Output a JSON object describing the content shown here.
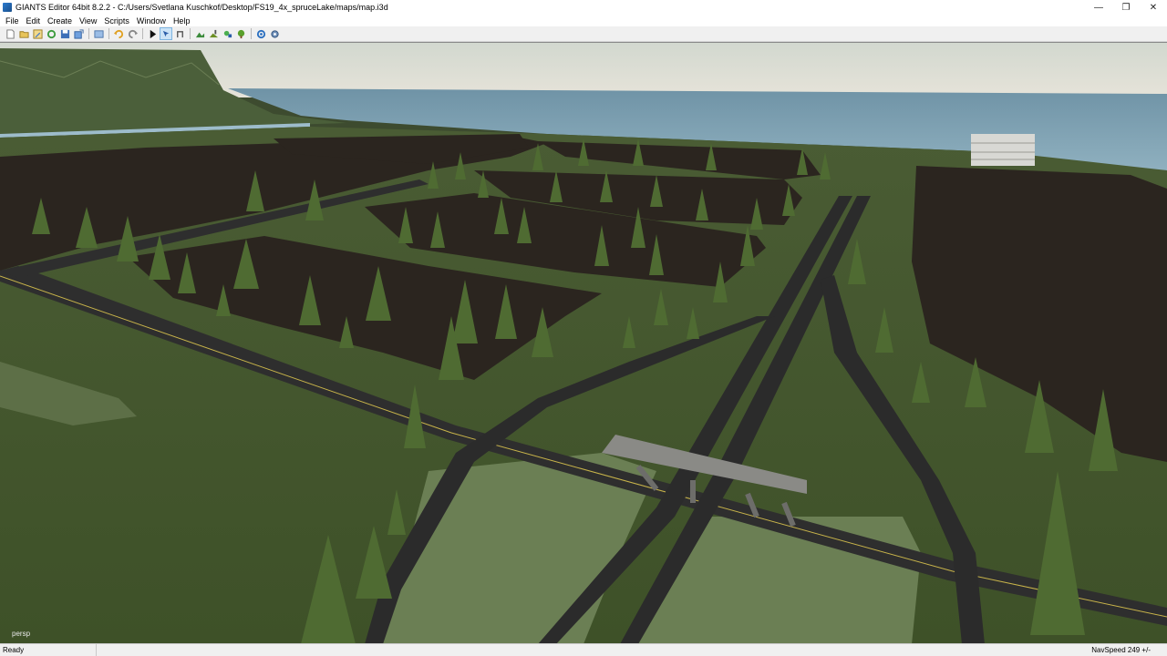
{
  "window": {
    "title": "GIANTS Editor 64bit 8.2.2 - C:/Users/Svetlana Kuschkof/Desktop/FS19_4x_spruceLake/maps/map.i3d",
    "minimize_glyph": "—",
    "maximize_glyph": "❐",
    "close_glyph": "✕"
  },
  "menu": [
    {
      "label": "File"
    },
    {
      "label": "Edit"
    },
    {
      "label": "Create"
    },
    {
      "label": "View"
    },
    {
      "label": "Scripts"
    },
    {
      "label": "Window"
    },
    {
      "label": "Help"
    }
  ],
  "toolbar": {
    "icons": [
      "new-icon",
      "open-icon",
      "save-as-icon",
      "reload-icon",
      "save-icon",
      "export-icon",
      "undo-history-icon",
      "undo-icon",
      "redo-icon",
      "play-icon",
      "select-tool-icon",
      "move-tool-icon",
      "terrain-sculpt-icon",
      "terrain-paint-icon",
      "foliage-paint-icon",
      "paint-tree-icon",
      "refresh-icon",
      "settings-icon"
    ]
  },
  "viewport": {
    "camera_label": "persp"
  },
  "status": {
    "left": "Ready",
    "right": "NavSpeed 249 +/-"
  }
}
